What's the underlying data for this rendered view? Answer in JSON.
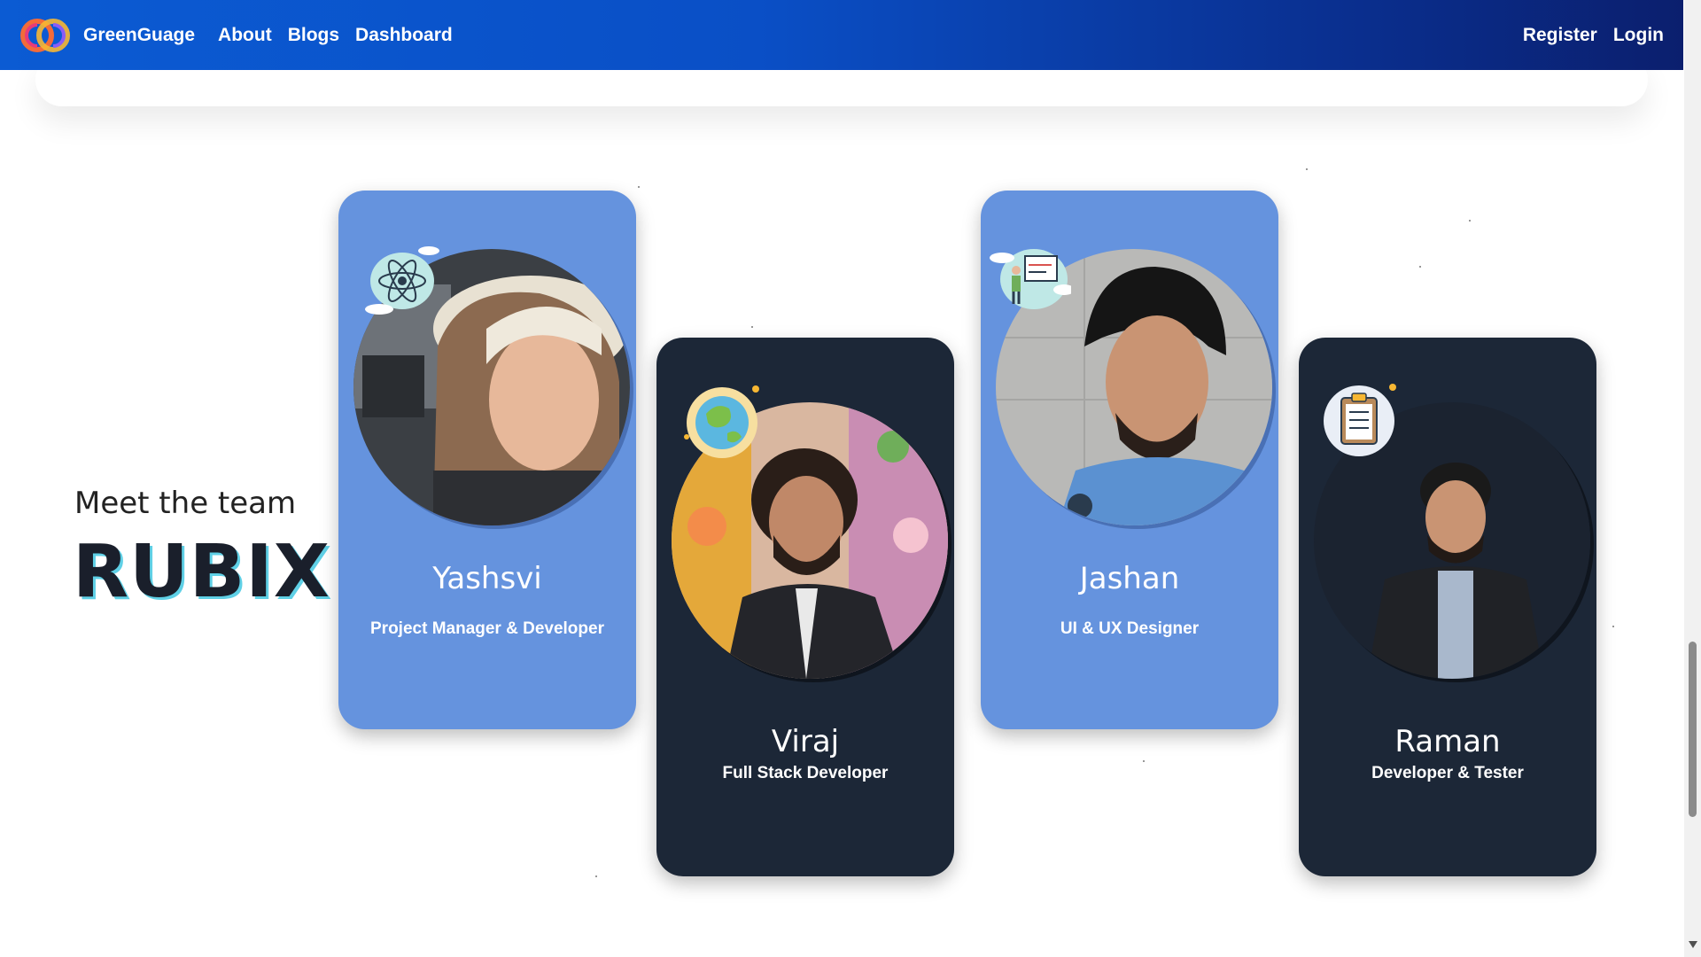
{
  "nav": {
    "brand": "GreenGuage",
    "links": [
      "About",
      "Blogs",
      "Dashboard"
    ],
    "right_links": [
      "Register",
      "Login"
    ],
    "gradient_start": "#0b5bd3",
    "gradient_end": "#0b1f6e"
  },
  "hero": {
    "intro": "Meet the team",
    "team_name": "RUBIX"
  },
  "members": [
    {
      "name": "Yashsvi",
      "role": "Project Manager & Developer",
      "badge": "atom-icon",
      "card_color": "#6593de"
    },
    {
      "name": "Viraj",
      "role": "Full Stack Developer",
      "badge": "globe-icon",
      "card_color": "#1c2737"
    },
    {
      "name": "Jashan",
      "role": "UI & UX Designer",
      "badge": "presentation-icon",
      "card_color": "#6593de"
    },
    {
      "name": "Raman",
      "role": "Developer & Tester",
      "badge": "clipboard-icon",
      "card_color": "#1c2737"
    }
  ]
}
